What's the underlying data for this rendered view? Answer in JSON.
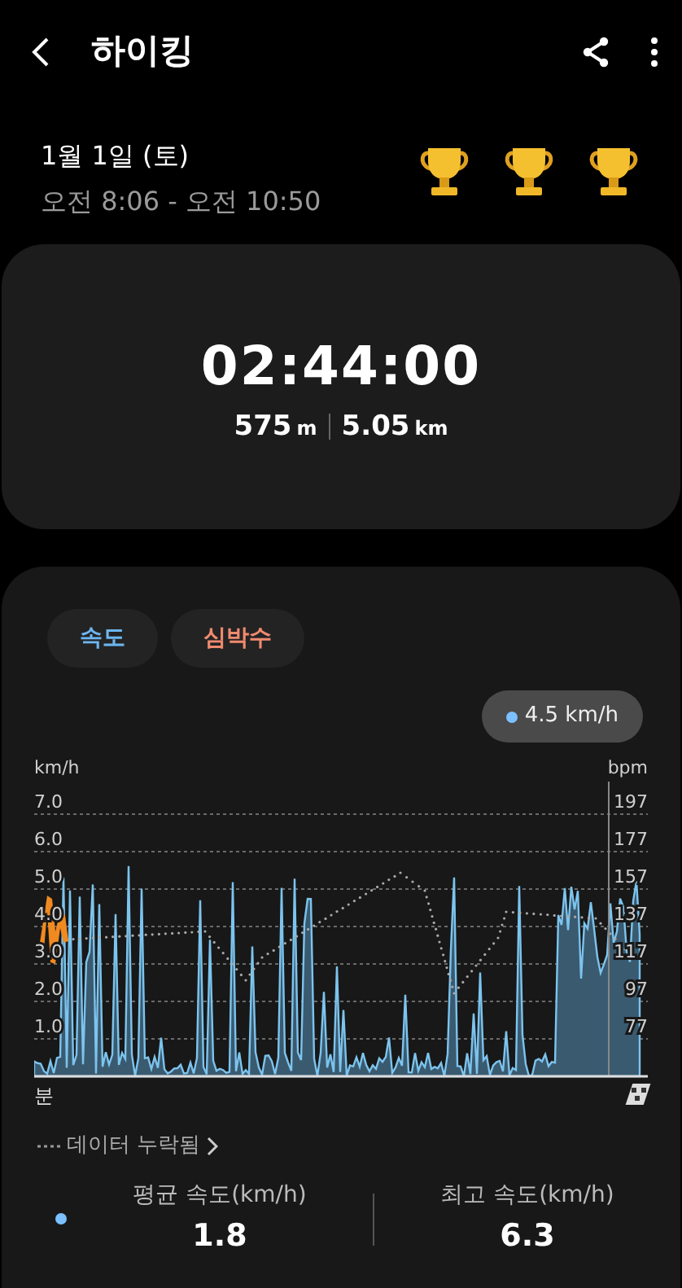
{
  "header": {
    "title": "하이킹"
  },
  "session": {
    "date": "1월 1일 (토)",
    "time_range": "오전 8:06 - 오전 10:50"
  },
  "summary": {
    "duration": "02:44:00",
    "metrics": [
      {
        "value": "575",
        "unit": "m"
      },
      {
        "value": "5.05",
        "unit": "km"
      }
    ]
  },
  "chart": {
    "chips": [
      {
        "label": "속도",
        "selected": true,
        "color": "#6cb6f0"
      },
      {
        "label": "심박수",
        "selected": true,
        "color": "#f08a70"
      }
    ],
    "tooltip": "4.5 km/h",
    "left_unit": "km/h",
    "right_unit": "bpm",
    "left_ticks": [
      "7.0",
      "6.0",
      "5.0",
      "4.0",
      "3.0",
      "2.0",
      "1.0"
    ],
    "right_ticks": [
      "197",
      "177",
      "157",
      "137",
      "117",
      "97",
      "77"
    ],
    "x_label": "분"
  },
  "missing_data_link": "데이터 누락됨",
  "stats": [
    {
      "label": "평균 속도(km/h)",
      "value": "1.8"
    },
    {
      "label": "최고 속도(km/h)",
      "value": "6.3"
    }
  ]
}
